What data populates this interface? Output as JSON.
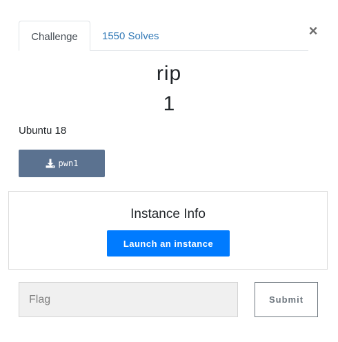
{
  "modal": {
    "close_label": "×"
  },
  "tabs": [
    {
      "label": "Challenge",
      "active": true
    },
    {
      "label": "1550 Solves",
      "active": false
    }
  ],
  "challenge": {
    "name": "rip",
    "value": "1",
    "description": "Ubuntu 18"
  },
  "files": [
    {
      "label": "pwn1",
      "icon": "download-icon"
    }
  ],
  "instance": {
    "title": "Instance Info",
    "launch_label": "Launch an instance"
  },
  "flag_form": {
    "placeholder": "Flag",
    "value": "",
    "submit_label": "Submit"
  },
  "colors": {
    "tab_link": "#337ab7",
    "file_button": "#5b7290",
    "launch_button": "#007bff",
    "submit_border": "#6c757d"
  }
}
